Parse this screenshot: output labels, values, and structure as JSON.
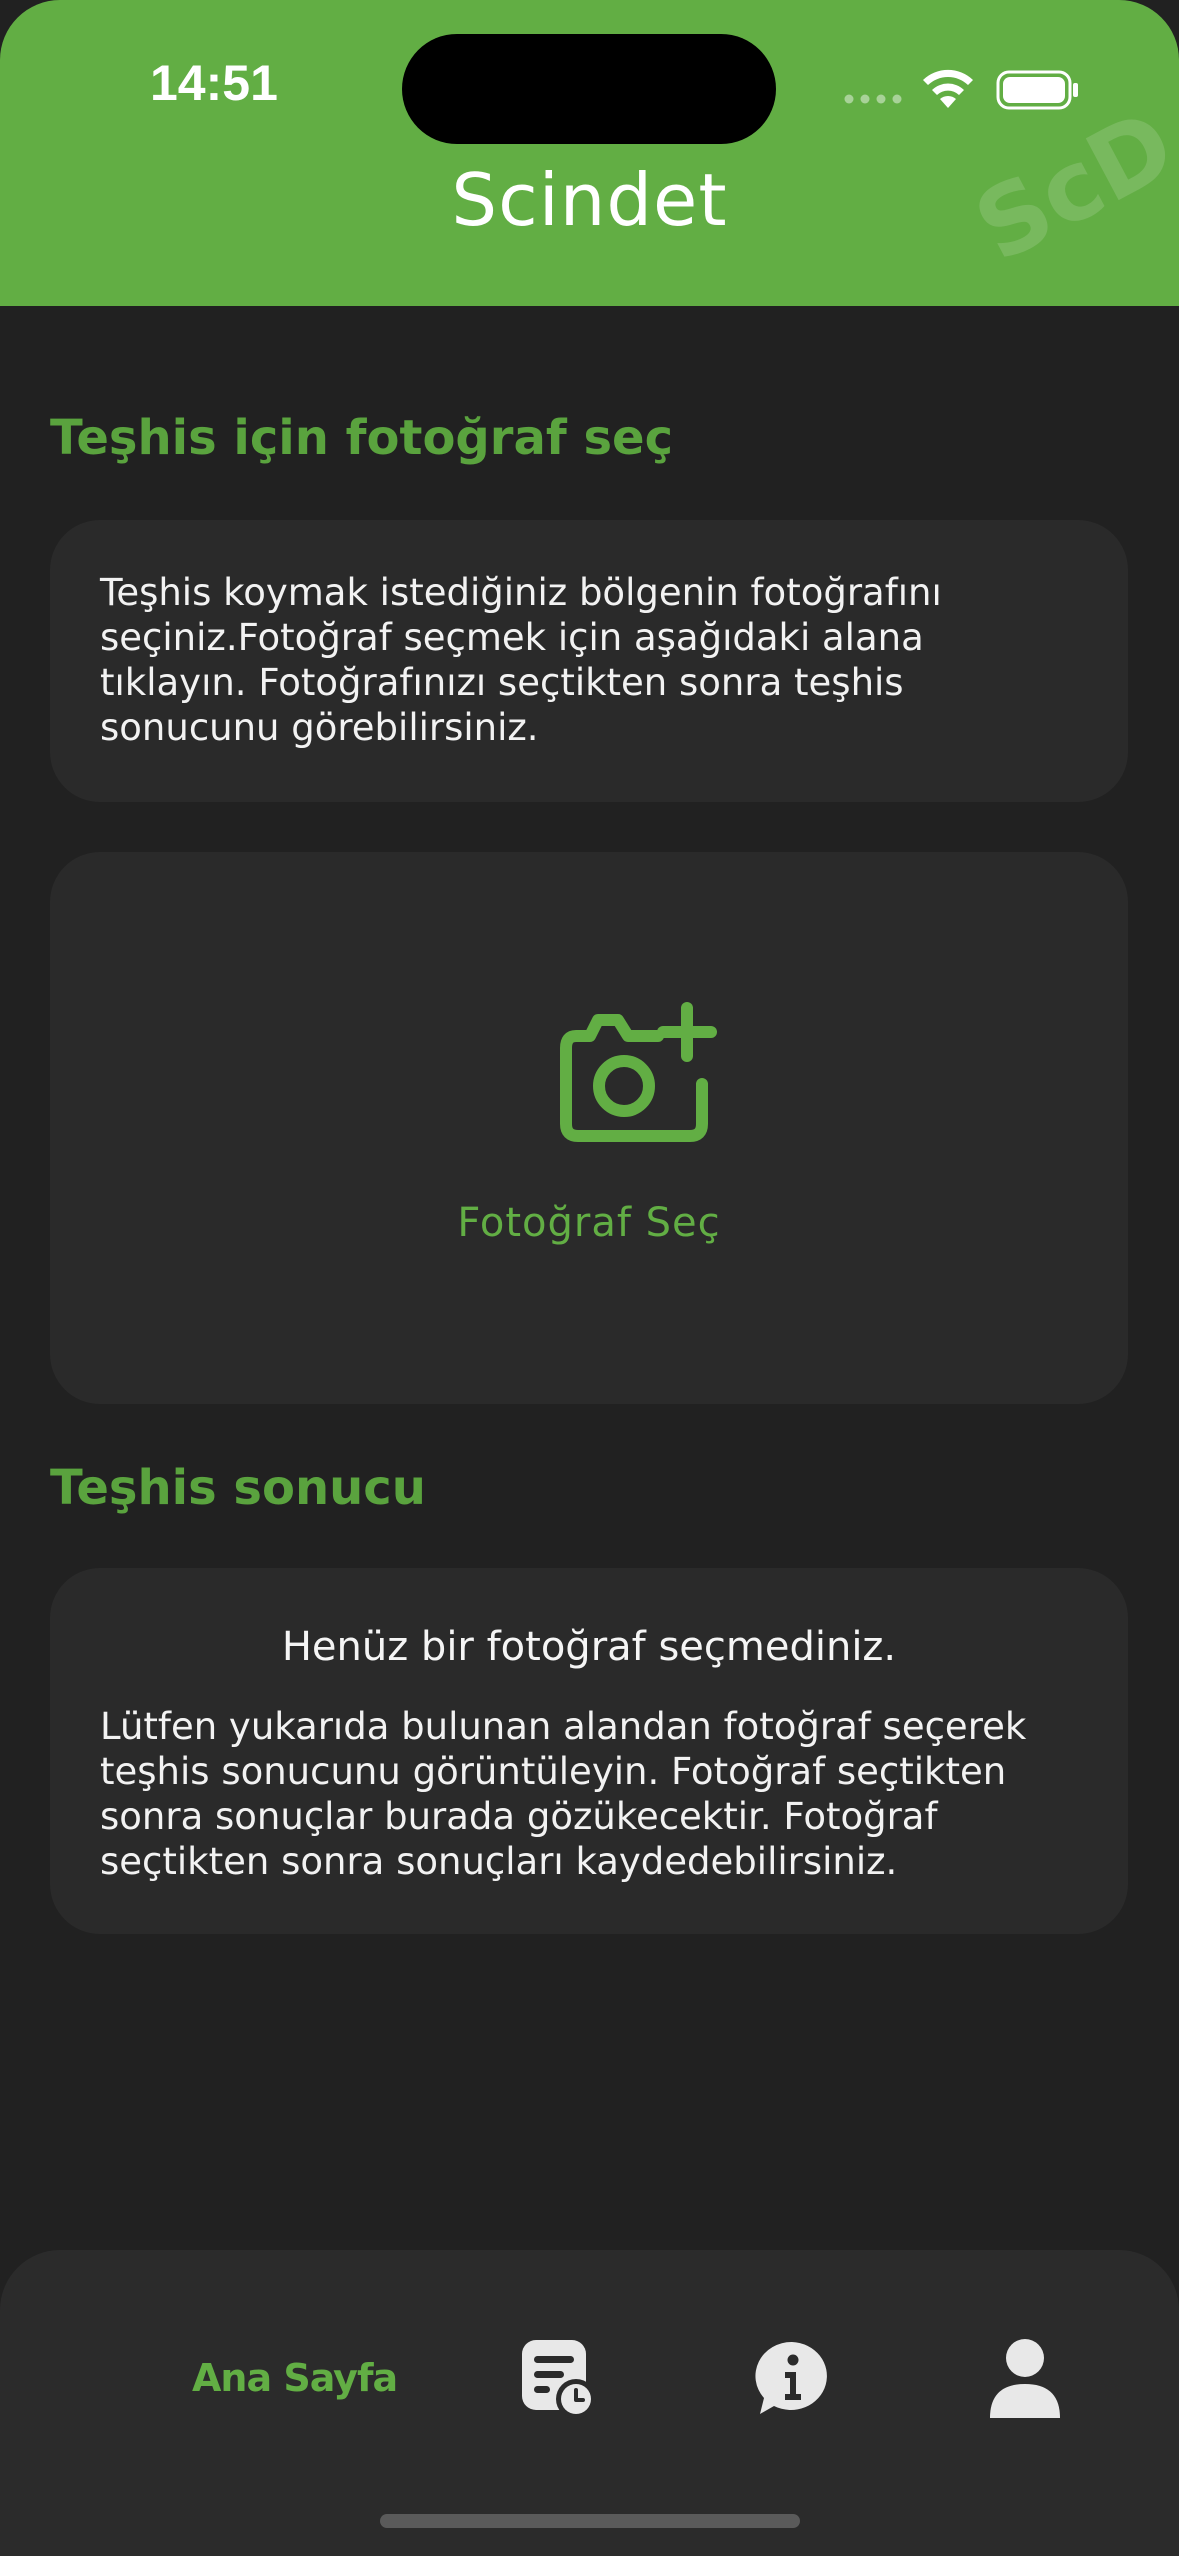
{
  "status_bar": {
    "time": "14:51"
  },
  "header": {
    "title": "Scindet",
    "watermark": "ScD"
  },
  "select_section": {
    "title": "Teşhis için fotoğraf seç",
    "description": "Teşhis koymak istediğiniz bölgenin fotoğrafını seçiniz.Fotoğraf seçmek için aşağıdaki alana tıklayın. Fotoğrafınızı seçtikten sonra teşhis sonucunu görebilirsiniz.",
    "picker_label": "Fotoğraf Seç"
  },
  "result_section": {
    "title": "Teşhis sonucu",
    "heading": "Henüz bir fotoğraf seçmediniz.",
    "description": "Lütfen yukarıda bulunan alandan fotoğraf seçerek teşhis sonucunu görüntüleyin. Fotoğraf seçtikten sonra sonuçlar burada gözükecektir. Fotoğraf seçtikten sonra sonuçları kaydedebilirsiniz."
  },
  "tab_bar": {
    "items": [
      {
        "label": "Ana Sayfa",
        "icon": "home-icon",
        "active": true
      },
      {
        "label": "",
        "icon": "history-icon",
        "active": false
      },
      {
        "label": "",
        "icon": "info-icon",
        "active": false
      },
      {
        "label": "",
        "icon": "profile-icon",
        "active": false
      }
    ]
  },
  "colors": {
    "accent": "#62ae44",
    "background": "#212121",
    "card": "#2a2a2a",
    "tab_bar": "#2b2b2b",
    "icon_inactive": "#e8e8e8"
  }
}
